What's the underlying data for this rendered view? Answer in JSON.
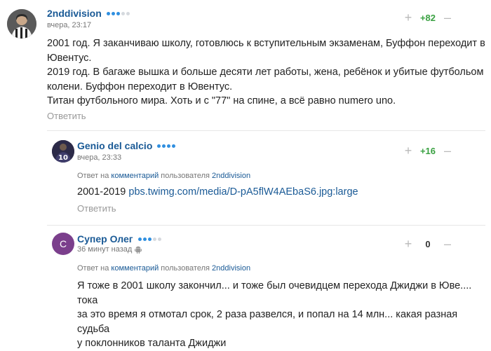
{
  "comments": [
    {
      "author": "2nddivision",
      "time": "вчера, 23:17",
      "score": "+82",
      "lines": [
        "2001 год. Я заканчиваю школу, готовлюсь к вступительным экзаменам, Буффон переходит в",
        "Ювентус.",
        "2019 год. В багаже вышка и больше десяти лет работы, жена, ребёнок и убитые футбольом",
        "колени. Буффон переходит в Ювентус.",
        "Титан футбольного мира. Хоть и с \"77\" на спине, а всё равно numero uno."
      ],
      "reply_label": "Ответить",
      "rating_dots": {
        "on": 3,
        "off": 2
      }
    },
    {
      "author": "Genio del calcio",
      "time": "вчера, 23:33",
      "score": "+16",
      "reply_to": {
        "prefix": "Ответ на",
        "comment": "комментарий",
        "middle": "пользователя",
        "user": "2nddivision"
      },
      "text_prefix": "2001-2019 ",
      "link": "pbs.twimg.com/media/D-pA5flW4AEbaS6.jpg:large",
      "reply_label": "Ответить",
      "avatar_text": "10",
      "rating_dots": {
        "on": 4,
        "off": 0
      }
    },
    {
      "author": "Супер Олег",
      "time": "36 минут назад",
      "score": "0",
      "reply_to": {
        "prefix": "Ответ на",
        "comment": "комментарий",
        "middle": "пользователя",
        "user": "2nddivision"
      },
      "avatar_letter": "С",
      "lines": [
        "Я тоже в 2001 школу закончил... и тоже был очевидцем перехода Джиджи в Юве.... тока",
        "за это время я отмотал срок, 2 раза развелся, и попал на 14 млн... какая разная судьба",
        "у поклонников таланта Джиджи"
      ],
      "rating_dots": {
        "on": 3,
        "off": 2
      }
    }
  ],
  "colors": {
    "link": "#1a5a96",
    "positive": "#3aa142",
    "dot_on": "#2f8fe0",
    "avatar3": "#7b3f8c"
  },
  "icons": {
    "plus": "+",
    "minus": "–",
    "platform": "android-icon"
  }
}
